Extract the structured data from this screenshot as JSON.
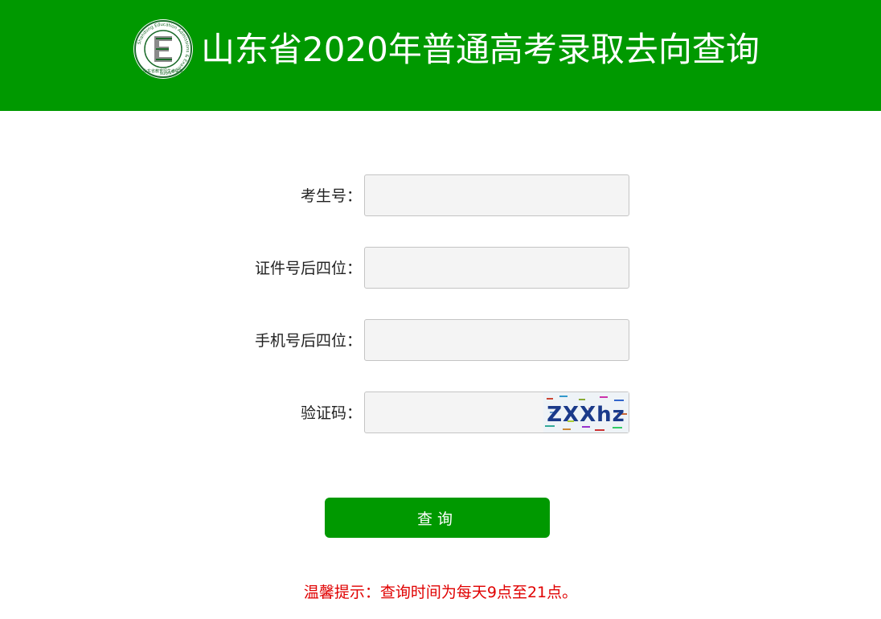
{
  "header": {
    "title": "山东省2020年普通高考录取去向查询",
    "logo_letter": "E",
    "logo_ring_text": "Shandong Education Admissions & Examinations",
    "logo_bottom_text": "山东省教育招生考试院"
  },
  "form": {
    "exam_number": {
      "label": "考生号：",
      "value": ""
    },
    "id_last_four": {
      "label": "证件号后四位：",
      "value": ""
    },
    "phone_last_four": {
      "label": "手机号后四位：",
      "value": ""
    },
    "captcha": {
      "label": "验证码：",
      "value": "",
      "captcha_text": "ZXXhz"
    }
  },
  "actions": {
    "query_label": "查询"
  },
  "notice": {
    "text": "温馨提示：查询时间为每天9点至21点。"
  },
  "colors": {
    "brand_green": "#009900",
    "notice_red": "#e00000",
    "input_bg": "#f4f4f4"
  }
}
